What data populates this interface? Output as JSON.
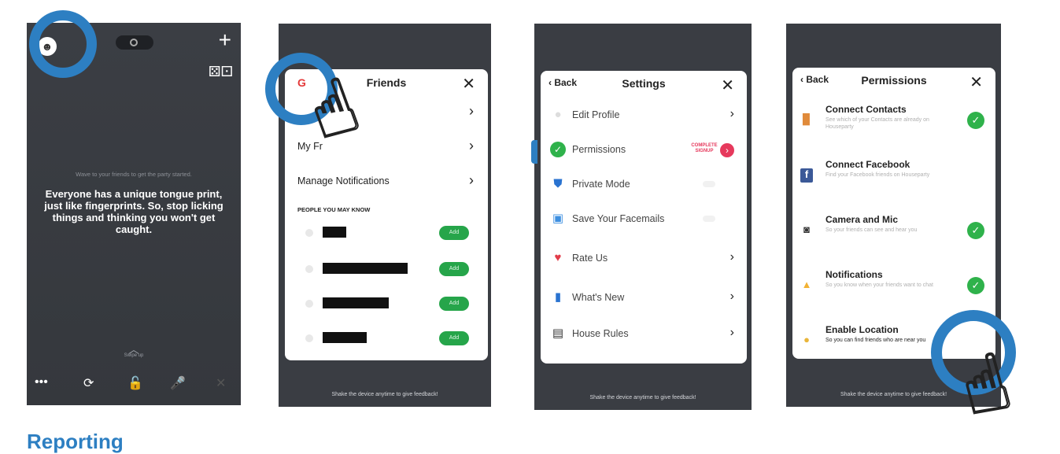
{
  "phone1": {
    "hint": "Wave to your friends to get the party started.",
    "fact": "Everyone has a unique tongue print, just like fingerprints. So, stop licking things and thinking you won't get caught.",
    "swipe_label": "Swipe up",
    "icons": {
      "plus": "+",
      "dice": "⚄⚀",
      "ghost": "☻"
    },
    "bottom_icons": [
      "•••",
      "⟳",
      "🔓",
      "🎤",
      "✕"
    ]
  },
  "friends": {
    "title": "Friends",
    "close": "✕",
    "rows": [
      "My Fr",
      "Manage Notifications"
    ],
    "section": "PEOPLE YOU MAY KNOW",
    "add_label": "Add",
    "footer": "Shake the device anytime to give feedback!"
  },
  "settings": {
    "back": "Back",
    "title": "Settings",
    "close": "✕",
    "items": [
      {
        "label": "Edit Profile"
      },
      {
        "label": "Permissions",
        "badge": "COMPLETE SIGNUP"
      },
      {
        "label": "Private Mode"
      },
      {
        "label": "Save Your Facemails"
      },
      {
        "label": "Rate Us"
      },
      {
        "label": "What's New"
      },
      {
        "label": "House Rules"
      }
    ],
    "footer": "Shake the device anytime to give feedback!"
  },
  "permissions": {
    "back": "Back",
    "title": "Permissions",
    "close": "✕",
    "items": [
      {
        "title": "Connect Contacts",
        "desc": "See which of your Contacts are already on Houseparty"
      },
      {
        "title": "Connect Facebook",
        "desc": "Find your Facebook friends on Houseparty"
      },
      {
        "title": "Camera and Mic",
        "desc": "So your friends can see and hear you"
      },
      {
        "title": "Notifications",
        "desc": "So you know when your friends want to chat"
      },
      {
        "title": "Enable Location",
        "desc": "So you can find friends who are near you"
      }
    ],
    "footer": "Shake the device anytime to give feedback!"
  },
  "heading": "Reporting"
}
